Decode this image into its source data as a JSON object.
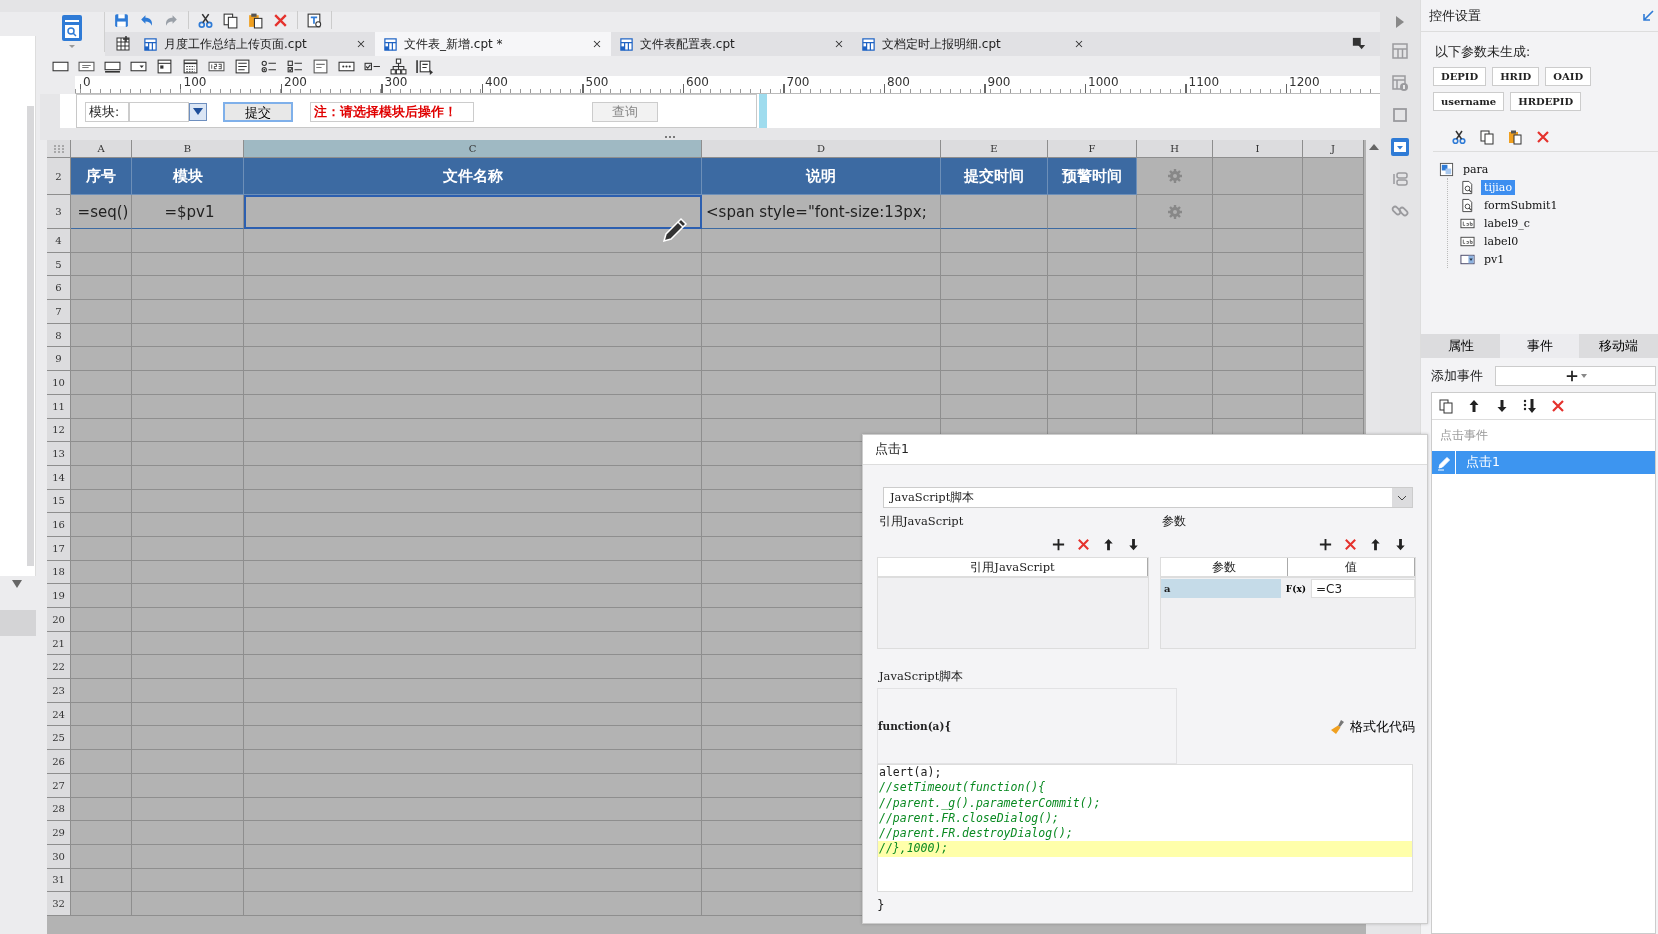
{
  "tabs": [
    {
      "label": "月度工作总结上传页面.cpt",
      "selected": false
    },
    {
      "label": "文件表_新增.cpt *",
      "selected": true
    },
    {
      "label": "文件表配置表.cpt",
      "selected": false
    },
    {
      "label": "文档定时上报明细.cpt",
      "selected": false
    }
  ],
  "ruler": {
    "ticks": [
      "0",
      "100",
      "200",
      "300",
      "400",
      "500",
      "600",
      "700",
      "800",
      "900",
      "1000",
      "1100",
      "1200"
    ]
  },
  "parameter_form": {
    "label": "模块:",
    "submit_button": {
      "label": "提交",
      "selected": true
    },
    "notice": "注：请选择模块后操作！",
    "query_button": {
      "label": "查询",
      "disabled": true
    }
  },
  "sheet": {
    "columns": [
      {
        "label": "A",
        "selected": false
      },
      {
        "label": "B",
        "selected": false
      },
      {
        "label": "C",
        "selected": true
      },
      {
        "label": "D",
        "selected": false
      },
      {
        "label": "E",
        "selected": false
      },
      {
        "label": "F",
        "selected": false
      },
      {
        "label": "H",
        "selected": false
      },
      {
        "label": "I",
        "selected": false
      },
      {
        "label": "J",
        "selected": false
      }
    ],
    "header_row": {
      "number": "2",
      "cells": [
        "序号",
        "模块",
        "文件名称",
        "说明",
        "提交时间",
        "预警时间"
      ]
    },
    "data_row": {
      "number": "3",
      "cells": [
        {
          "text": "=seq()",
          "selected": false
        },
        {
          "text": "=$pv1",
          "selected": false
        },
        {
          "selected": true
        },
        {
          "text": "<span style=\"font-size:13px;",
          "selected": false
        },
        {
          "selected": false
        },
        {
          "selected": false
        }
      ]
    },
    "empty_rows": [
      "4",
      "5",
      "6",
      "7",
      "8",
      "9",
      "10",
      "11",
      "12",
      "13",
      "14",
      "15",
      "16",
      "17",
      "18",
      "19",
      "20",
      "21",
      "22",
      "23",
      "24",
      "25",
      "26",
      "27",
      "28",
      "29",
      "30",
      "31",
      "32"
    ]
  },
  "side_panel": {
    "title": "控件设置",
    "notice": "以下参数未生成:",
    "parameters": [
      "DEPID",
      "HRID",
      "OAID",
      "username",
      "HRDEPID"
    ],
    "tree": {
      "label": "para",
      "kind": "container",
      "selected": false,
      "children": [
        {
          "label": "tijiao",
          "kind": "button",
          "selected": true
        },
        {
          "label": "formSubmit1",
          "kind": "button",
          "selected": false
        },
        {
          "label": "label9_c",
          "kind": "label",
          "selected": false
        },
        {
          "label": "label0",
          "kind": "label",
          "selected": false
        },
        {
          "label": "pv1",
          "kind": "combo",
          "selected": false
        }
      ]
    },
    "tabs": [
      {
        "label": "属性",
        "selected": false
      },
      {
        "label": "事件",
        "selected": true
      },
      {
        "label": "移动端",
        "selected": false
      }
    ],
    "add_event_label": "添加事件",
    "event_list": {
      "header": "点击事件",
      "items": [
        {
          "label": "点击1",
          "selected": true
        }
      ]
    }
  },
  "dialog": {
    "title": "点击1",
    "script_type": "JavaScript脚本",
    "references": {
      "title": "引用JavaScript",
      "columns": [
        "引用JavaScript"
      ]
    },
    "parameters": {
      "title": "参数",
      "columns": [
        "参数",
        "值"
      ],
      "rows": [
        {
          "name": "a",
          "formula_label": "F(x)",
          "value": "=C3",
          "selected": true
        }
      ]
    },
    "script": {
      "title": "JavaScript脚本",
      "signature": "function(a){",
      "format_button": "格式化代码",
      "lines": [
        {
          "text": "alert(a);",
          "kind": "code",
          "highlighted": false
        },
        {
          "text": "//setTimeout(function(){",
          "kind": "comment",
          "highlighted": false
        },
        {
          "text": "//parent._g().parameterCommit();",
          "kind": "comment",
          "highlighted": false
        },
        {
          "text": "//parent.FR.closeDialog();",
          "kind": "comment",
          "highlighted": false
        },
        {
          "text": "//parent.FR.destroyDialog();",
          "kind": "comment",
          "highlighted": false
        },
        {
          "text": "//},1000);",
          "kind": "comment",
          "highlighted": true
        }
      ],
      "closing": "}"
    }
  }
}
